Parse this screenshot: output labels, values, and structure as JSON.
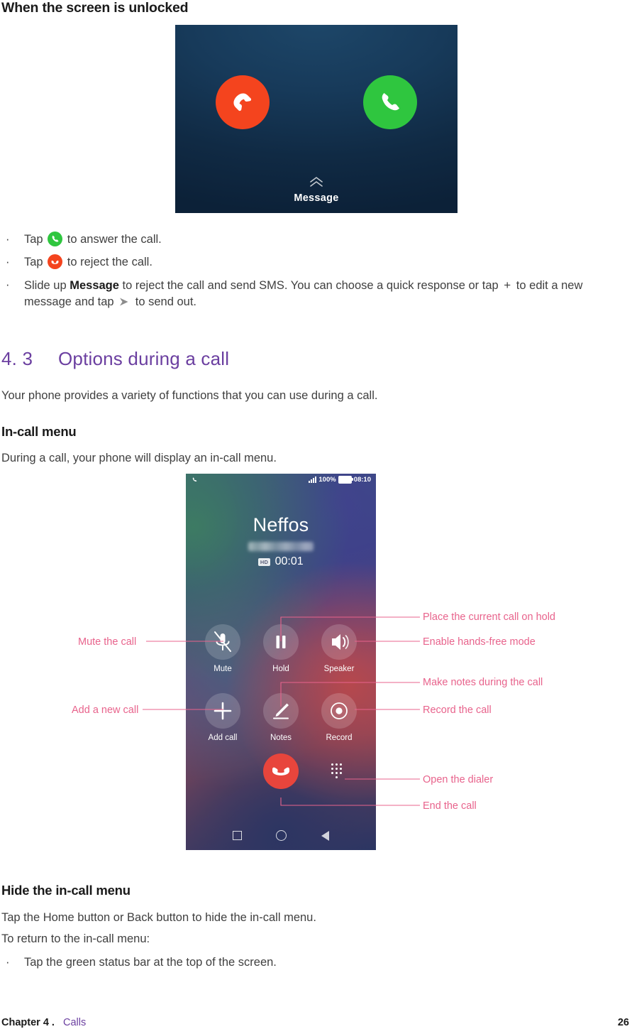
{
  "page": {
    "section_title": "When the screen is unlocked",
    "chapter_number": "4. 3",
    "chapter_title": "Options during a call",
    "intro_paragraph": "Your phone provides a variety of functions that you can use during a call.",
    "incall_heading": "In-call menu",
    "incall_paragraph": "During a call, your phone will display an in-call menu.",
    "hide_heading": "Hide the in-call menu",
    "hide_paragraph_1": "Tap the Home button or Back button to hide the in-call menu.",
    "hide_paragraph_2": "To return to the in-call menu:",
    "hide_bullet_1": "Tap the green status bar at the top of the screen."
  },
  "bullets": [
    {
      "marker": "·",
      "prefix": "Tap ",
      "icon": "answer-call-icon",
      "suffix": " to answer the call."
    },
    {
      "marker": "·",
      "prefix": "Tap ",
      "icon": "reject-call-icon",
      "suffix": " to reject the call."
    },
    {
      "marker": "·",
      "text_part_1": "Slide up ",
      "bold": "Message",
      "text_part_2": " to reject the call and send SMS. You can choose a quick response or tap ",
      "plus": "+",
      "text_part_3": " to edit a new message and tap ",
      "send_icon": "send-arrow-icon",
      "text_part_4": " to send out."
    }
  ],
  "incoming_call_screen": {
    "reject_button_label": "reject-call",
    "accept_button_label": "answer-call",
    "swipe_hint": "Message",
    "bg_top_color": "#1d4668",
    "bg_bottom_color": "#0c2138",
    "reject_color": "#f4441e",
    "accept_color": "#2fc63f"
  },
  "incall_screen": {
    "status_bar": {
      "call_icon": "phone-handset-icon",
      "signal": "signal-bars-icon",
      "battery_percent": "100%",
      "battery_icon": "battery-full-icon",
      "time": "08:10"
    },
    "caller_name": "Neffos",
    "caller_number": "",
    "hd_badge": "HD",
    "call_timer": "00:01",
    "actions": [
      {
        "icon": "mute-microphone-icon",
        "label": "Mute"
      },
      {
        "icon": "pause-icon",
        "label": "Hold"
      },
      {
        "icon": "speaker-icon",
        "label": "Speaker"
      },
      {
        "icon": "plus-icon",
        "label": "Add call"
      },
      {
        "icon": "pencil-icon",
        "label": "Notes"
      },
      {
        "icon": "record-dot-icon",
        "label": "Record"
      }
    ],
    "end_call_button": "end-call-icon",
    "dialpad_button": "dialpad-icon",
    "nav_bar": [
      "recents-square-icon",
      "home-circle-icon",
      "back-triangle-icon"
    ],
    "end_call_color": "#e8453c"
  },
  "callouts": {
    "accent_color": "#E8638C",
    "left": [
      {
        "label": "Mute the call",
        "target": "mute-button"
      },
      {
        "label": "Add a new call",
        "target": "add-call-button"
      }
    ],
    "right": [
      {
        "label": "Place the current call on hold",
        "target": "hold-button"
      },
      {
        "label": "Enable hands-free mode",
        "target": "speaker-button"
      },
      {
        "label": "Make notes during the call",
        "target": "notes-button"
      },
      {
        "label": "Record the call",
        "target": "record-button"
      },
      {
        "label": "Open the dialer",
        "target": "dialpad-button"
      },
      {
        "label": "End the call",
        "target": "end-call-button"
      }
    ]
  },
  "footer": {
    "chapter": "Chapter 4 .",
    "chapter_link": "Calls",
    "page_number": "26",
    "link_color": "#6B3FA0"
  }
}
